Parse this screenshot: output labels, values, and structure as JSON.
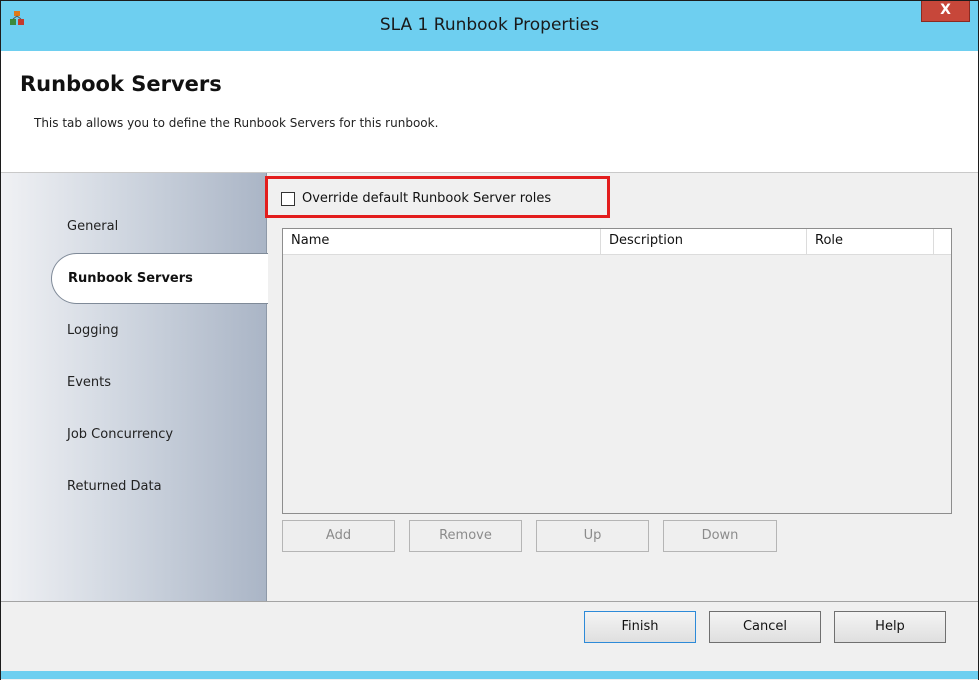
{
  "window": {
    "title": "SLA 1 Runbook Properties",
    "close_label": "X"
  },
  "header": {
    "title": "Runbook Servers",
    "description": "This tab allows you to define the Runbook Servers for this runbook."
  },
  "sidebar": {
    "items": [
      {
        "label": "General",
        "selected": false
      },
      {
        "label": "Runbook Servers",
        "selected": true
      },
      {
        "label": "Logging",
        "selected": false
      },
      {
        "label": "Events",
        "selected": false
      },
      {
        "label": "Job Concurrency",
        "selected": false
      },
      {
        "label": "Returned Data",
        "selected": false
      }
    ]
  },
  "override": {
    "label": "Override default Runbook Server roles",
    "checked": false
  },
  "server_list": {
    "columns": [
      "Name",
      "Description",
      "Role"
    ],
    "rows": []
  },
  "list_buttons": {
    "add": "Add",
    "remove": "Remove",
    "up": "Up",
    "down": "Down"
  },
  "footer": {
    "finish": "Finish",
    "cancel": "Cancel",
    "help": "Help"
  },
  "colors": {
    "titlebar": "#6ecff0",
    "close_button": "#c7473a",
    "highlight_border": "#e31d1d"
  }
}
